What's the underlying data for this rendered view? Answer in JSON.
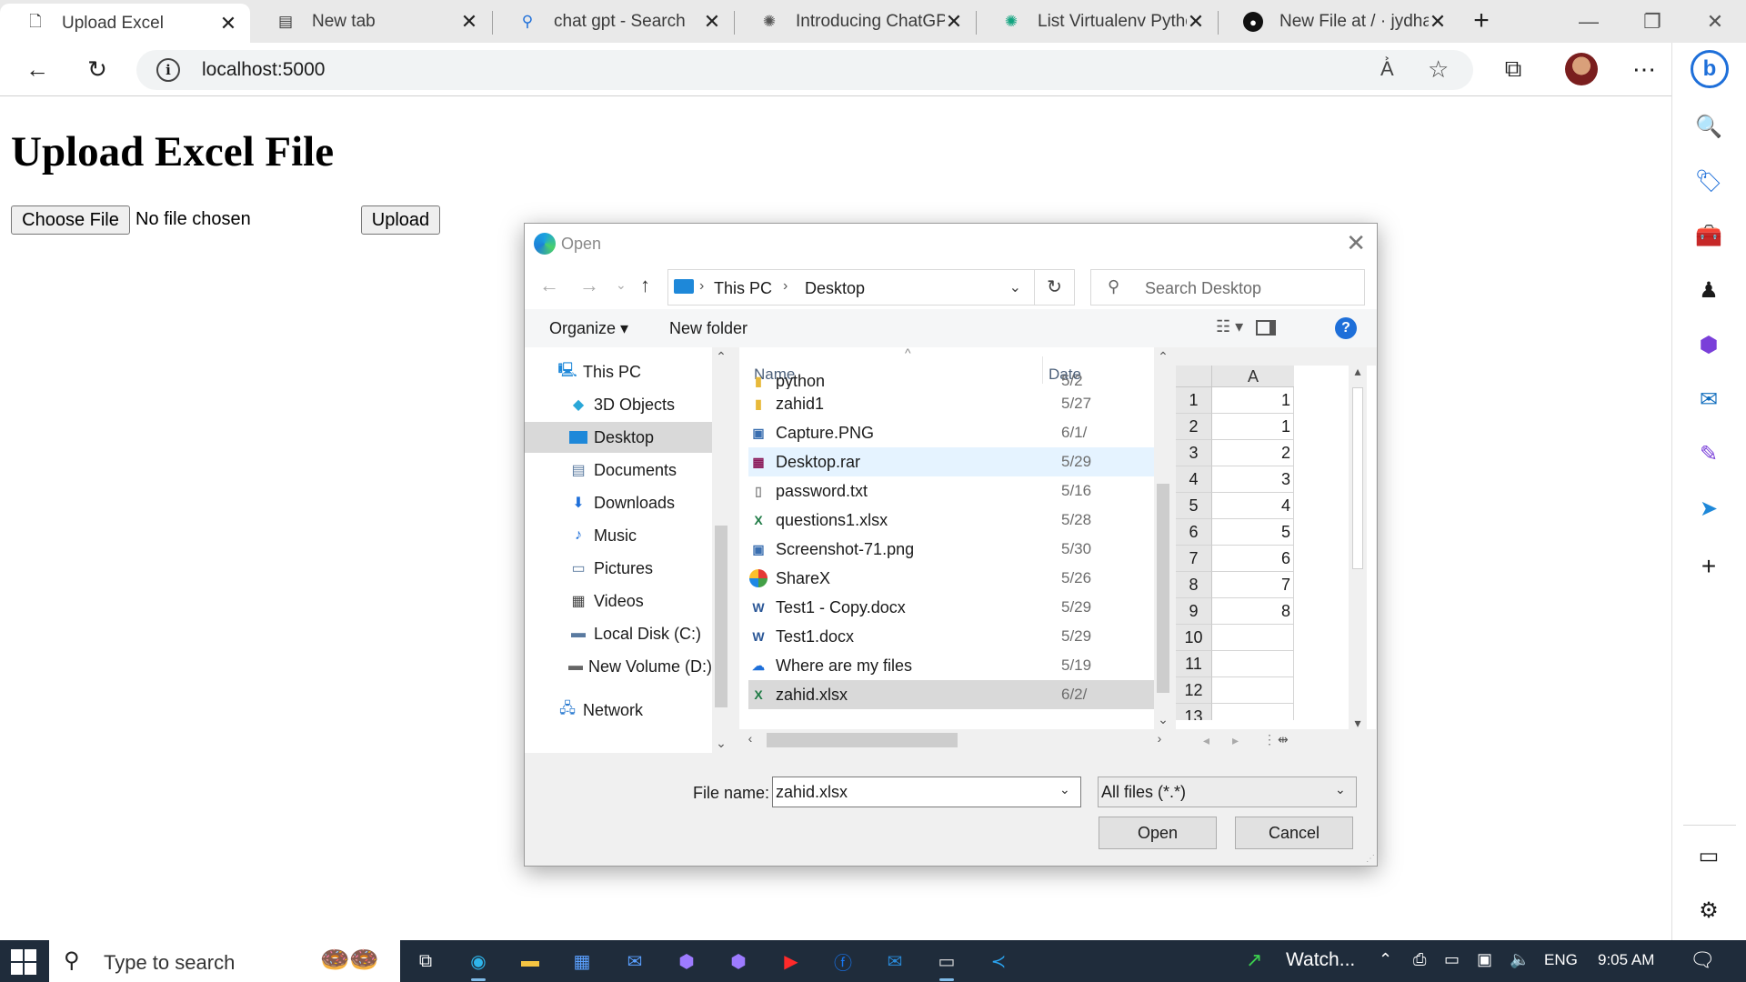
{
  "browser": {
    "tabs": [
      {
        "label": "Upload Excel",
        "icon": "page-icon",
        "active": true
      },
      {
        "label": "New tab",
        "icon": "newtab-icon",
        "active": false
      },
      {
        "label": "chat gpt - Search",
        "icon": "search-icon",
        "active": false
      },
      {
        "label": "Introducing ChatGPT",
        "icon": "openai-icon",
        "active": false
      },
      {
        "label": "List Virtualenv Pytho",
        "icon": "openai-icon",
        "active": false
      },
      {
        "label": "New File at / · jydhas",
        "icon": "github-icon",
        "active": false
      }
    ],
    "address_url": "localhost:5000",
    "colors": {
      "tabstrip": "#e9e9e9",
      "edge_blue": "#1e6fd9"
    }
  },
  "page": {
    "title": "Upload Excel File",
    "choose_file_label": "Choose File",
    "no_file_text": "No file chosen",
    "upload_label": "Upload"
  },
  "dialog": {
    "title": "Open",
    "breadcrumb": [
      "This PC",
      "Desktop"
    ],
    "search_placeholder": "Search Desktop",
    "organize_label": "Organize",
    "new_folder_label": "New folder",
    "help_glyph": "?",
    "nav_items": [
      {
        "label": "This PC",
        "icon": "computer-icon"
      },
      {
        "label": "3D Objects",
        "icon": "cube-icon"
      },
      {
        "label": "Desktop",
        "icon": "desktop-icon",
        "selected": true
      },
      {
        "label": "Documents",
        "icon": "documents-icon"
      },
      {
        "label": "Downloads",
        "icon": "downloads-icon"
      },
      {
        "label": "Music",
        "icon": "music-icon"
      },
      {
        "label": "Pictures",
        "icon": "pictures-icon"
      },
      {
        "label": "Videos",
        "icon": "videos-icon"
      },
      {
        "label": "Local Disk (C:)",
        "icon": "drive-icon"
      },
      {
        "label": "New Volume (D:)",
        "icon": "drive-icon"
      },
      {
        "label": "Network",
        "icon": "network-icon"
      }
    ],
    "columns": {
      "name": "Name",
      "date": "Date"
    },
    "files": [
      {
        "name": "python",
        "date": "5/2",
        "icon": "folder-icon",
        "partial": true
      },
      {
        "name": "zahid1",
        "date": "5/27",
        "icon": "folder-icon"
      },
      {
        "name": "Capture.PNG",
        "date": "6/1/",
        "icon": "image-icon"
      },
      {
        "name": "Desktop.rar",
        "date": "5/29",
        "icon": "rar-icon",
        "state": "hover"
      },
      {
        "name": "password.txt",
        "date": "5/16",
        "icon": "text-file-icon"
      },
      {
        "name": "questions1.xlsx",
        "date": "5/28",
        "icon": "excel-icon"
      },
      {
        "name": "Screenshot-71.png",
        "date": "5/30",
        "icon": "image-icon"
      },
      {
        "name": "ShareX",
        "date": "5/26",
        "icon": "sharex-icon"
      },
      {
        "name": "Test1 - Copy.docx",
        "date": "5/29",
        "icon": "word-icon"
      },
      {
        "name": "Test1.docx",
        "date": "5/29",
        "icon": "word-icon"
      },
      {
        "name": "Where are my files",
        "date": "5/19",
        "icon": "onedrive-icon"
      },
      {
        "name": "zahid.xlsx",
        "date": "6/2/",
        "icon": "excel-icon",
        "state": "selected"
      }
    ],
    "preview": {
      "column": "A",
      "rows": [
        {
          "n": "1",
          "v": "1"
        },
        {
          "n": "2",
          "v": "1"
        },
        {
          "n": "3",
          "v": "2"
        },
        {
          "n": "4",
          "v": "3"
        },
        {
          "n": "5",
          "v": "4"
        },
        {
          "n": "6",
          "v": "5"
        },
        {
          "n": "7",
          "v": "6"
        },
        {
          "n": "8",
          "v": "7"
        },
        {
          "n": "9",
          "v": "8"
        },
        {
          "n": "10",
          "v": ""
        },
        {
          "n": "11",
          "v": ""
        },
        {
          "n": "12",
          "v": ""
        },
        {
          "n": "13",
          "v": ""
        }
      ]
    },
    "file_name_label": "File name:",
    "file_name_value": "zahid.xlsx",
    "file_type_value": "All files (*.*)",
    "open_label": "Open",
    "cancel_label": "Cancel"
  },
  "sidebar": {
    "icons": [
      "bing-icon",
      "search-icon",
      "shopping-icon",
      "tools-icon",
      "games-icon",
      "office-icon",
      "outlook-icon",
      "designer-icon",
      "telegram-icon",
      "add-icon",
      "split-screen-icon",
      "settings-icon"
    ]
  },
  "taskbar": {
    "search_placeholder": "Type to search",
    "apps": [
      "task-view-icon",
      "edge-icon",
      "file-explorer-icon",
      "store-icon",
      "mail-icon",
      "copilot-icon",
      "copilot-icon",
      "youtube-icon",
      "facebook-icon",
      "outlook-icon",
      "terminal-icon",
      "vscode-icon"
    ],
    "watch_label": "Watch...",
    "language": "ENG",
    "time": "9:05 AM"
  }
}
